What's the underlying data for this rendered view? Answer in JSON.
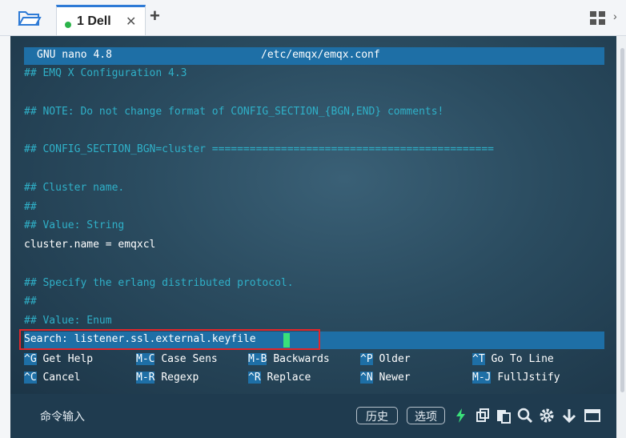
{
  "tabbar": {
    "folder_icon": "folder-open-icon",
    "tab_label": "1 Dell",
    "tab_status_color": "#2bb34a",
    "close_glyph": "✕",
    "add_glyph": "+",
    "layout_icon": "grid-icon",
    "menu_glyph": "›"
  },
  "terminal": {
    "title_left": "GNU nano 4.8",
    "title_center": "/etc/emqx/emqx.conf",
    "lines": [
      "## EMQ X Configuration 4.3",
      "",
      "## NOTE: Do not change format of CONFIG_SECTION_{BGN,END} comments!",
      "",
      "## CONFIG_SECTION_BGN=cluster =============================================",
      "",
      "## Cluster name.",
      "##",
      "## Value: String",
      "cluster.name = emqxcl",
      "",
      "## Specify the erlang distributed protocol.",
      "##",
      "## Value: Enum"
    ],
    "search_prompt": "Search: listener.ssl.external.keyfile",
    "shortcuts_row1": [
      {
        "key": "^G",
        "label": "Get Help"
      },
      {
        "key": "M-C",
        "label": "Case Sens"
      },
      {
        "key": "M-B",
        "label": "Backwards"
      },
      {
        "key": "^P",
        "label": "Older"
      },
      {
        "key": "^T",
        "label": "Go To Line"
      }
    ],
    "shortcuts_row2": [
      {
        "key": "^C",
        "label": "Cancel"
      },
      {
        "key": "M-R",
        "label": "Regexp"
      },
      {
        "key": "^R",
        "label": "Replace"
      },
      {
        "key": "^N",
        "label": "Newer"
      },
      {
        "key": "M-J",
        "label": "FullJstify"
      }
    ],
    "colors": {
      "comment": "#2fb0c8",
      "bar": "#1e6fa6",
      "cursor": "#3ae07a",
      "highlight_box": "#e1262b"
    }
  },
  "cmdbar": {
    "label": "命令输入",
    "history_button": "历史",
    "options_button": "选项",
    "icons": [
      "lightning-icon",
      "copy-icon",
      "paste-icon",
      "search-icon",
      "gear-icon",
      "download-icon",
      "window-icon"
    ]
  }
}
